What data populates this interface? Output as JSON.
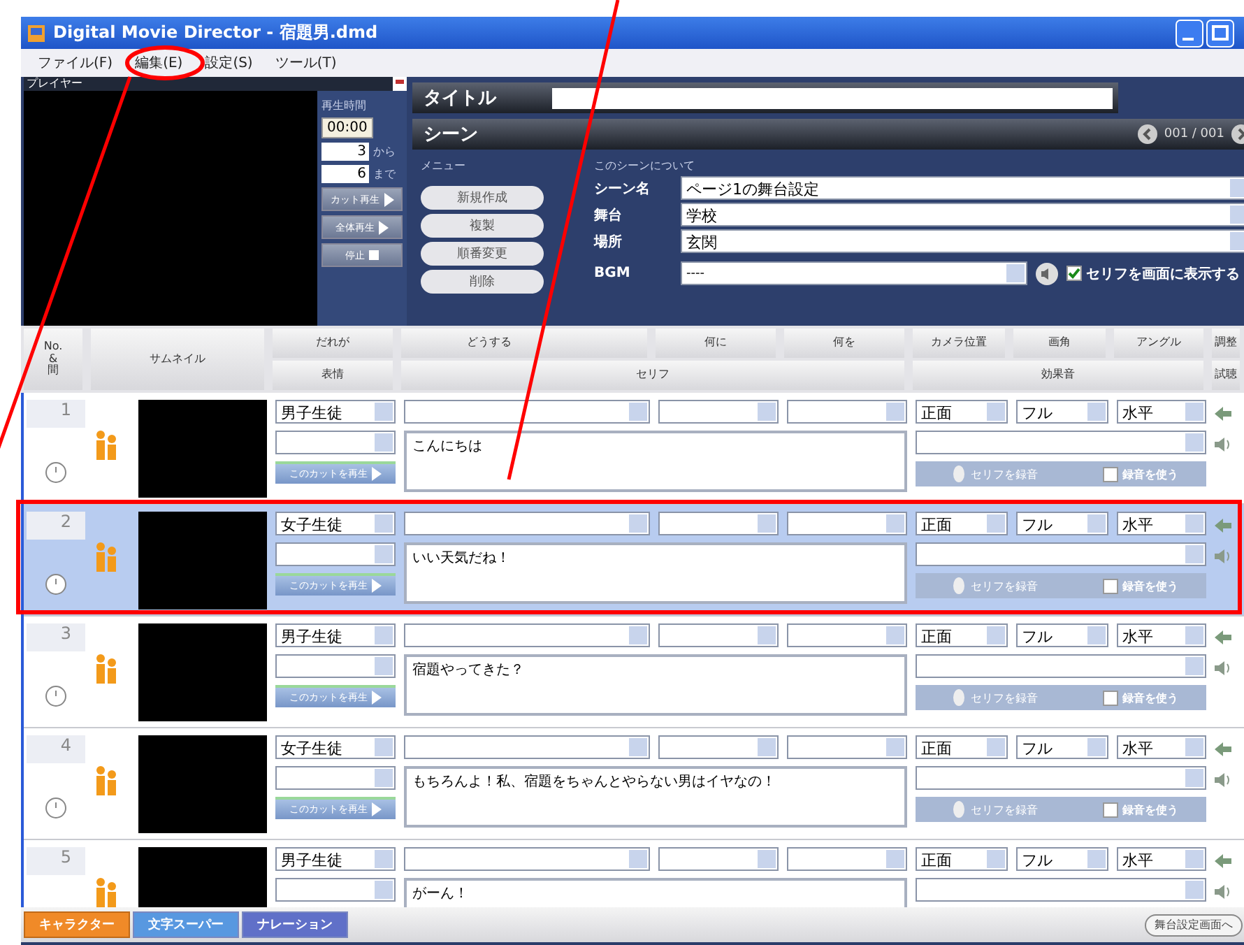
{
  "window": {
    "title": "Digital Movie Director - 宿題男.dmd"
  },
  "menu": [
    "ファイル(F)",
    "編集(E)",
    "設定(S)",
    "ツール(T)"
  ],
  "player": {
    "title": "プレイヤー",
    "time_label": "再生時間",
    "time": "00:00",
    "from_value": "3",
    "from_label": "から",
    "to_value": "6",
    "to_label": "まで",
    "buttons": [
      {
        "label": "カット再生",
        "kind": "play"
      },
      {
        "label": "全体再生",
        "kind": "play"
      },
      {
        "label": "停止",
        "kind": "stop"
      }
    ]
  },
  "title_label": "タイトル",
  "scene": {
    "label": "シーン",
    "page": "001 / 001",
    "menu_label": "メニュー",
    "menu_buttons": [
      "新規作成",
      "複製",
      "順番変更",
      "削除"
    ],
    "about_label": "このシーンについて",
    "fields": [
      {
        "label": "シーン名",
        "value": "ページ1の舞台設定"
      },
      {
        "label": "舞台",
        "value": "学校"
      },
      {
        "label": "場所",
        "value": "玄関"
      }
    ],
    "bgm": {
      "label": "BGM",
      "value": "----"
    },
    "show_dialogue": {
      "label": "セリフを画面に表示する",
      "checked": true
    }
  },
  "columns": {
    "top": [
      "No.\n&\n間",
      "サムネイル",
      "だれが",
      "どうする",
      "何に",
      "何を",
      "カメラ位置",
      "画角",
      "アングル",
      "調整"
    ],
    "bottom": [
      "表情",
      "セリフ",
      "効果音",
      "試聴"
    ]
  },
  "rows": [
    {
      "number": "1",
      "selected": false,
      "who": "男子生徒",
      "dialogue": "こんにちは",
      "camera": "正面",
      "shot": "フル",
      "angle": "水平",
      "play_button": "このカットを再生",
      "record_button": "セリフを録音",
      "use_recording": {
        "label": "録音を使う",
        "checked": false
      }
    },
    {
      "number": "2",
      "selected": true,
      "who": "女子生徒",
      "dialogue": "いい天気だね！",
      "camera": "正面",
      "shot": "フル",
      "angle": "水平",
      "play_button": "このカットを再生",
      "record_button": "セリフを録音",
      "use_recording": {
        "label": "録音を使う",
        "checked": false
      }
    },
    {
      "number": "3",
      "selected": false,
      "who": "男子生徒",
      "dialogue": "宿題やってきた？",
      "camera": "正面",
      "shot": "フル",
      "angle": "水平",
      "play_button": "このカットを再生",
      "record_button": "セリフを録音",
      "use_recording": {
        "label": "録音を使う",
        "checked": false
      }
    },
    {
      "number": "4",
      "selected": false,
      "who": "女子生徒",
      "dialogue": "もちろんよ！私、宿題をちゃんとやらない男はイヤなの！",
      "camera": "正面",
      "shot": "フル",
      "angle": "水平",
      "play_button": "このカットを再生",
      "record_button": "セリフを録音",
      "use_recording": {
        "label": "録音を使う",
        "checked": false
      }
    },
    {
      "number": "5",
      "selected": false,
      "who": "男子生徒",
      "dialogue": "がーん！",
      "camera": "正面",
      "shot": "フル",
      "angle": "水平"
    }
  ],
  "bottom_tabs": [
    {
      "label": "キャラクター",
      "selected": true
    },
    {
      "label": "文字スーパー",
      "selected": false
    },
    {
      "label": "ナレーション",
      "selected": false
    }
  ],
  "next_button": "舞台設定画面へ"
}
